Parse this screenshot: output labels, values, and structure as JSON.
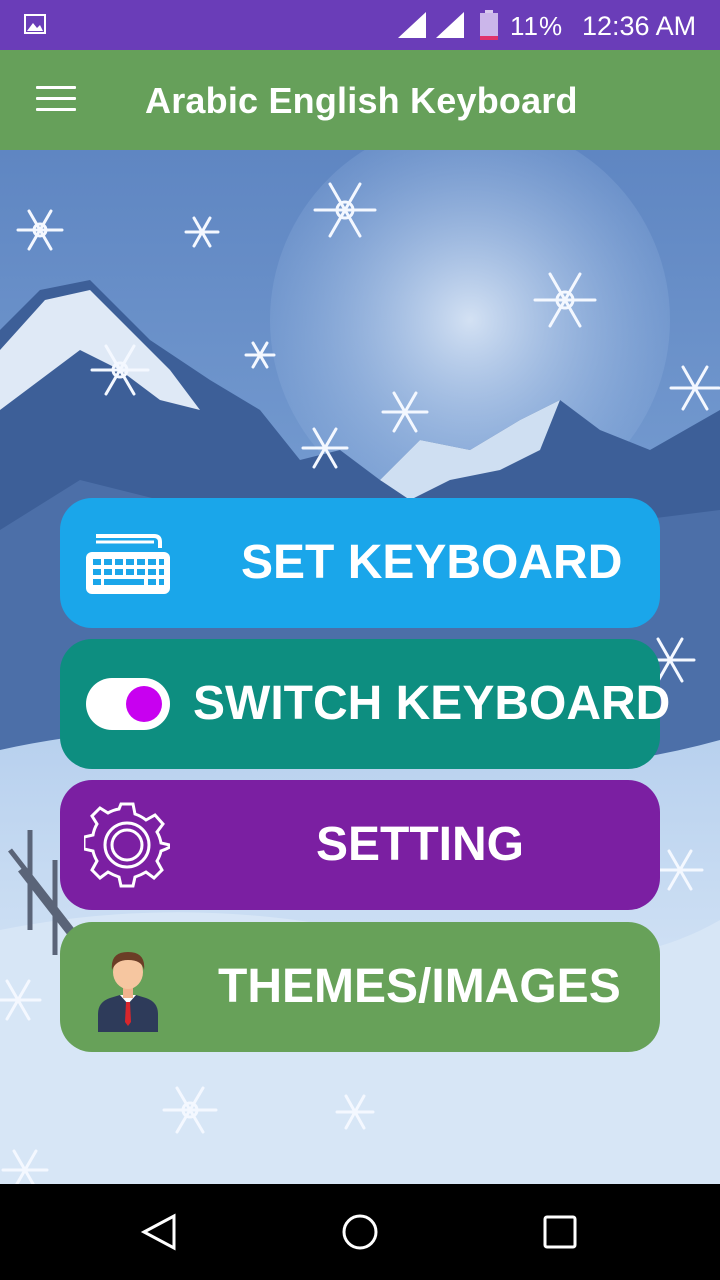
{
  "status_bar": {
    "battery_percent": "11%",
    "time": "12:36 AM",
    "icons": [
      "image-notification-icon",
      "signal-icon",
      "signal-icon",
      "battery-icon"
    ]
  },
  "app_bar": {
    "title": "Arabic English Keyboard",
    "menu_icon": "hamburger-menu-icon"
  },
  "buttons": {
    "set_keyboard": {
      "label": "SET KEYBOARD",
      "icon": "keyboard-icon",
      "color": "#1aa6ea"
    },
    "switch_keyboard": {
      "label": "SWITCH KEYBOARD",
      "icon": "toggle-switch-icon",
      "color": "#0d8e80",
      "toggle_on": true
    },
    "setting": {
      "label": "SETTING",
      "icon": "gear-icon",
      "color": "#7b1fa2"
    },
    "themes_images": {
      "label": "THEMES/IMAGES",
      "icon": "person-avatar-icon",
      "color": "#67a159"
    }
  },
  "colors": {
    "status_bar": "#6a3db8",
    "app_bar": "#66a05a",
    "nav_bar": "#000000"
  },
  "nav_bar": {
    "icons": [
      "back-triangle-icon",
      "home-circle-icon",
      "recents-square-icon"
    ]
  }
}
